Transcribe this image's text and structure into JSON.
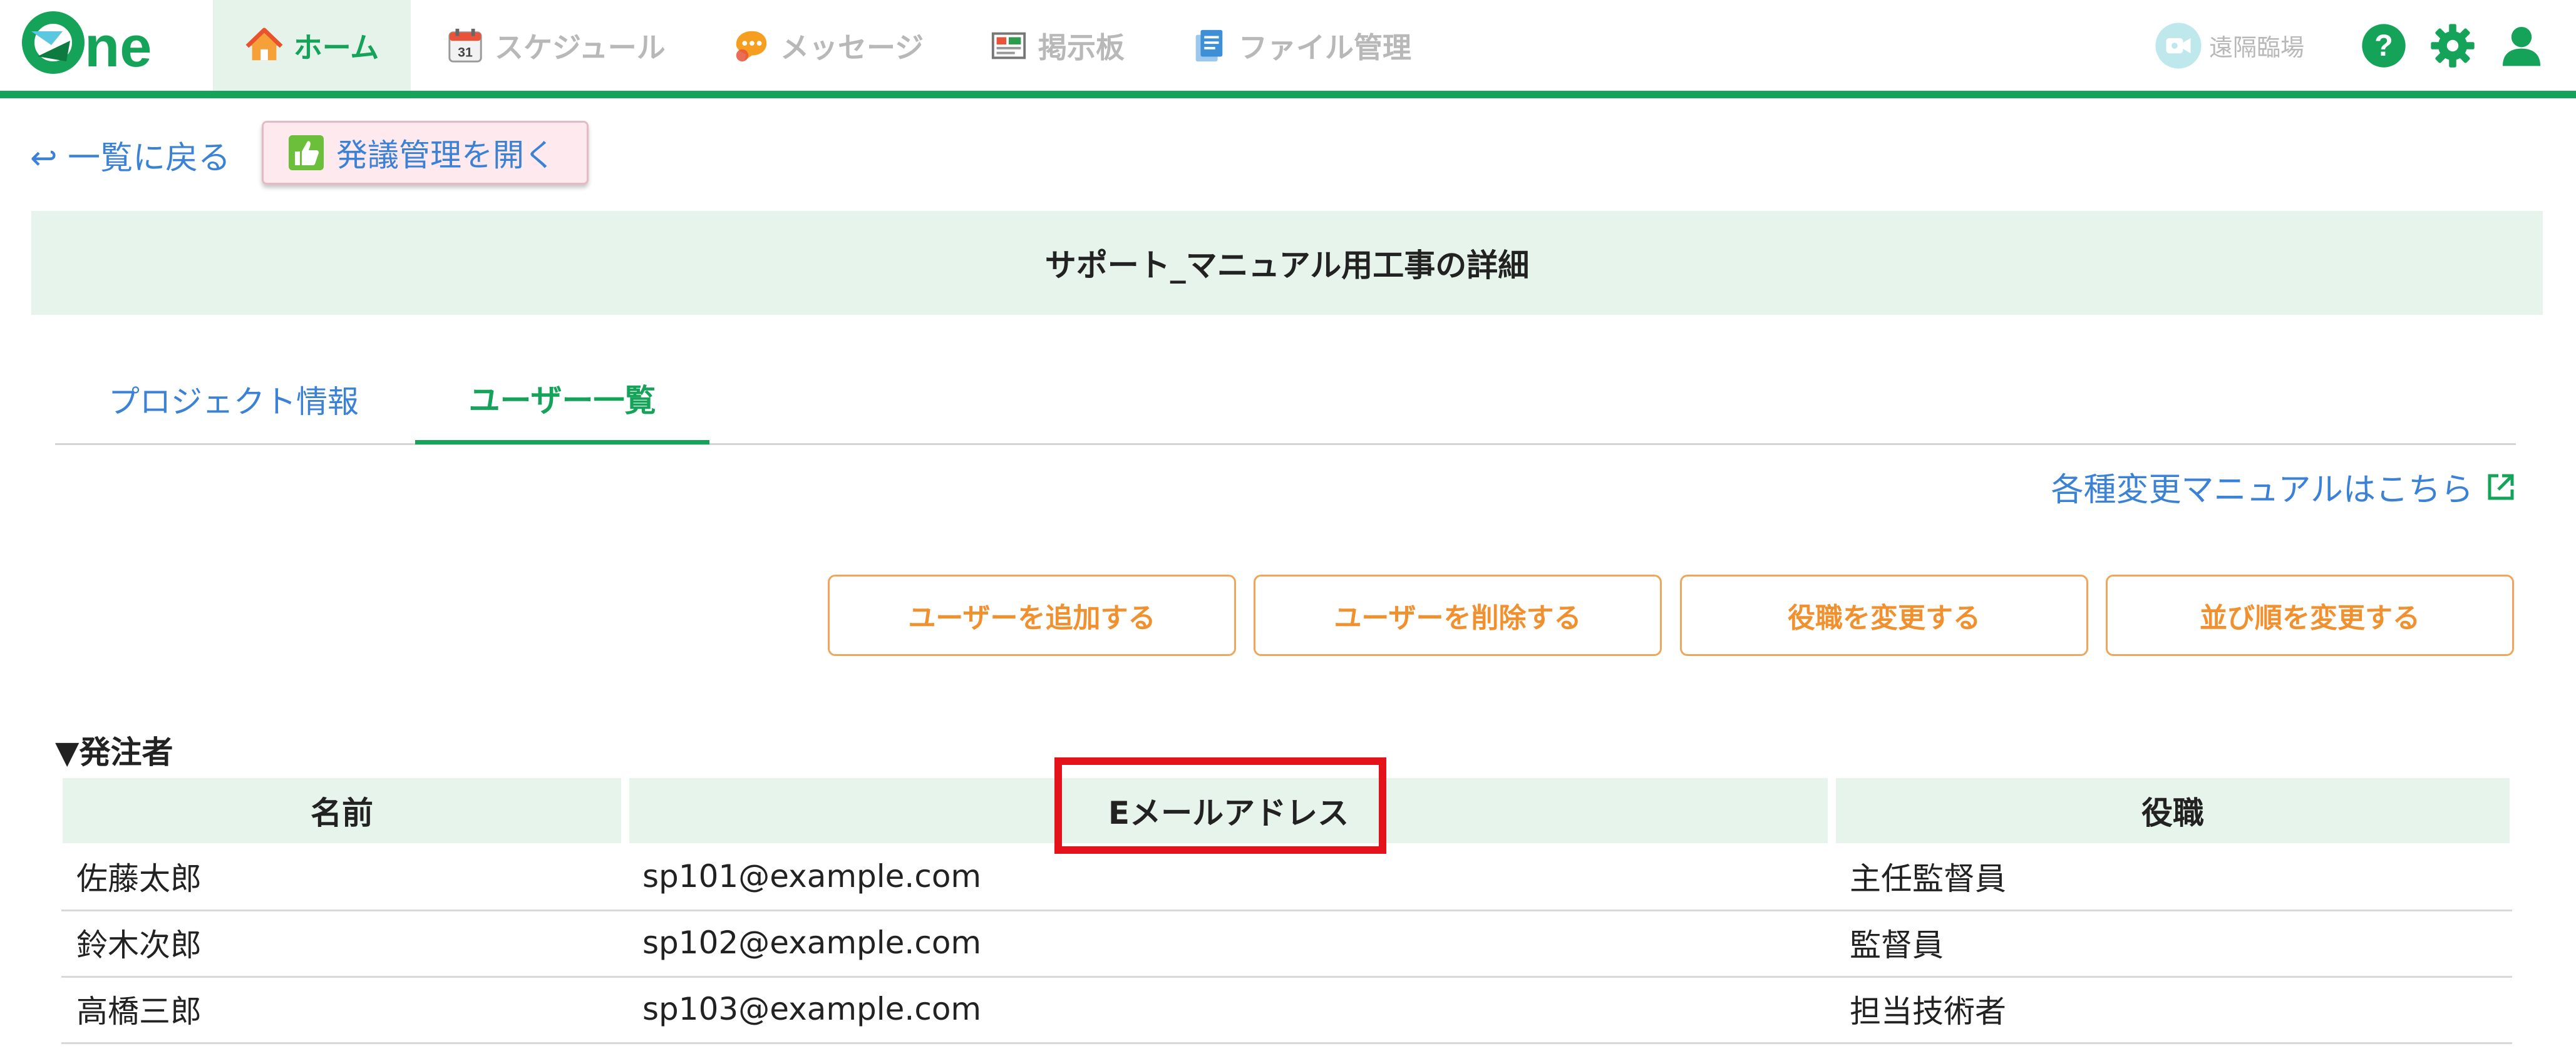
{
  "header": {
    "logo_text": "One",
    "nav": [
      {
        "label": "ホーム",
        "icon": "home-icon",
        "active": true
      },
      {
        "label": "スケジュール",
        "icon": "calendar-icon",
        "calendar_day": "31"
      },
      {
        "label": "メッセージ",
        "icon": "chat-icon"
      },
      {
        "label": "掲示板",
        "icon": "bulletin-board-icon"
      },
      {
        "label": "ファイル管理",
        "icon": "files-icon"
      }
    ],
    "remote_label": "遠隔臨場",
    "help_icon": "help-icon",
    "settings_icon": "gear-icon",
    "user_icon": "user-icon",
    "accent_color": "#15a35a"
  },
  "subnav": {
    "back_label": "↩ 一覧に戻る",
    "open_button_label": "発議管理を開く"
  },
  "page_title": "サポート_マニュアル用工事の詳細",
  "tabs": [
    {
      "label": "プロジェクト情報",
      "active": false
    },
    {
      "label": "ユーザー一覧",
      "active": true
    }
  ],
  "manual_link": "各種変更マニュアルはこちら",
  "actions": [
    {
      "label": "ユーザーを追加する"
    },
    {
      "label": "ユーザーを削除する"
    },
    {
      "label": "役職を変更する"
    },
    {
      "label": "並び順を変更する"
    }
  ],
  "section": {
    "title": "▼発注者",
    "columns": [
      "名前",
      "Eメールアドレス",
      "役職"
    ],
    "rows": [
      {
        "name": "佐藤太郎",
        "email": "sp101@example.com",
        "role": "主任監督員"
      },
      {
        "name": "鈴木次郎",
        "email": "sp102@example.com",
        "role": "監督員"
      },
      {
        "name": "高橋三郎",
        "email": "sp103@example.com",
        "role": "担当技術者"
      }
    ],
    "highlighted_column": "Eメールアドレス",
    "highlight_color": "#e3121b"
  }
}
